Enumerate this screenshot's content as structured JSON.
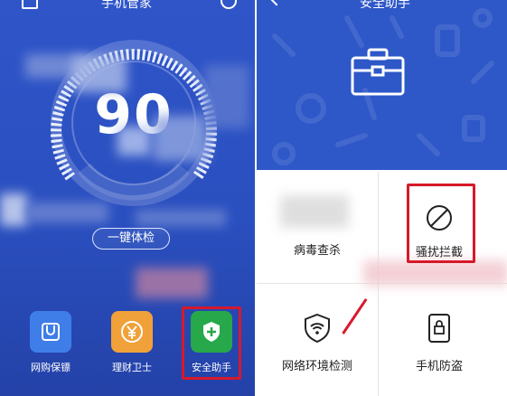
{
  "left_screen": {
    "title": "手机管家",
    "score": "90",
    "check_button": "一键体检",
    "tools": [
      {
        "label": "网购保镖",
        "icon": "shopping-bag-icon",
        "color": "#3f7ee8"
      },
      {
        "label": "理财卫士",
        "icon": "yen-coin-icon",
        "color": "#f0a13a"
      },
      {
        "label": "安全助手",
        "icon": "shield-plus-icon",
        "color": "#27a84a"
      }
    ]
  },
  "right_screen": {
    "title": "安全助手",
    "hero_icon": "toolbox-icon",
    "features": [
      {
        "label": "病毒查杀",
        "icon": "virus-scan-icon"
      },
      {
        "label": "骚扰拦截",
        "icon": "block-icon"
      },
      {
        "label": "网络环境检测",
        "icon": "wifi-shield-icon"
      },
      {
        "label": "手机防盗",
        "icon": "phone-lock-icon"
      }
    ]
  },
  "colors": {
    "primary_blue": "#2e57c8",
    "highlight_red": "#d7192a"
  }
}
